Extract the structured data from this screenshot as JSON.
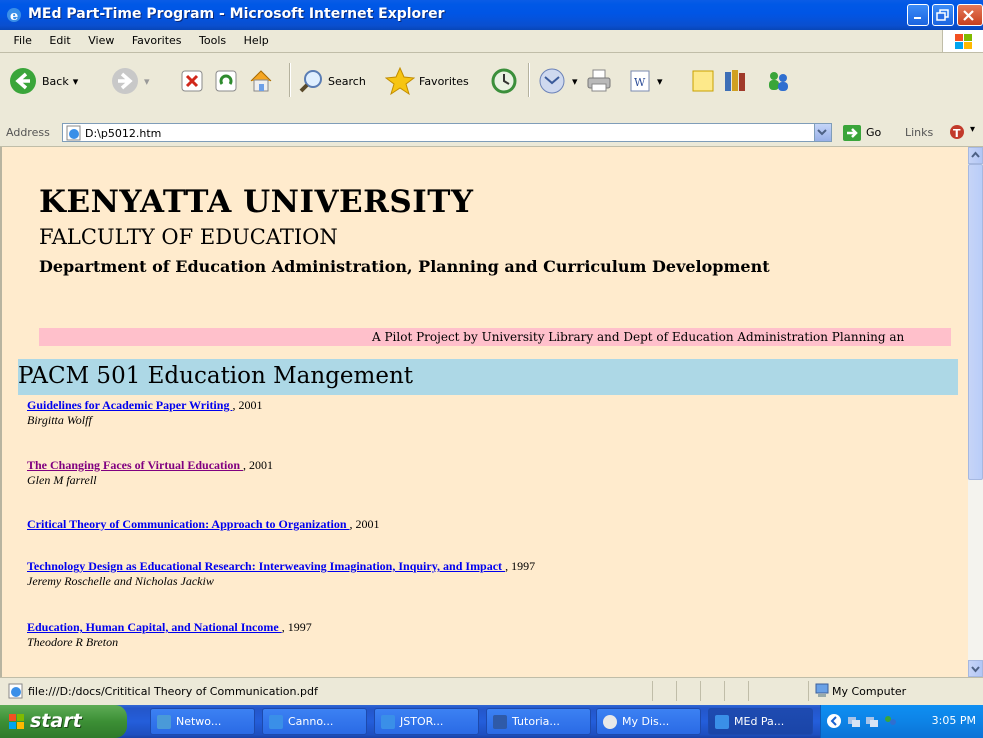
{
  "window": {
    "title": "MEd Part-Time Program - Microsoft Internet Explorer"
  },
  "menu": [
    "File",
    "Edit",
    "View",
    "Favorites",
    "Tools",
    "Help"
  ],
  "toolbar": {
    "back": "Back",
    "search": "Search",
    "favorites": "Favorites"
  },
  "address": {
    "label": "Address",
    "value": "D:\\p5012.htm",
    "go": "Go",
    "links": "Links"
  },
  "page": {
    "university": "KENYATTA UNIVERSITY",
    "faculty": "FALCULTY OF EDUCATION",
    "department": "Department of Education Administration, Planning and Curriculum Development",
    "marquee": "A Pilot Project by University Library and Dept of Education Administration Planning an",
    "course": "PACM 501 Education Mangement",
    "entries": [
      {
        "title": "Guidelines for Academic Paper Writing ",
        "year": ", 2001",
        "author": "Birgitta Wolff",
        "visited": false
      },
      {
        "title": "The Changing Faces of Virtual Education ",
        "year": ", 2001",
        "author": "Glen M farrell",
        "visited": true
      },
      {
        "title": "Critical Theory of Communication: Approach to Organization ",
        "year": ", 2001",
        "author": "",
        "visited": false
      },
      {
        "title": "Technology Design as Educational Research: Interweaving Imagination, Inquiry, and Impact ",
        "year": ", 1997",
        "author": "Jeremy Roschelle and Nicholas Jackiw",
        "visited": false
      },
      {
        "title": "Education, Human Capital, and National Income ",
        "year": ", 1997",
        "author": "Theodore R Breton",
        "visited": false
      }
    ]
  },
  "status": {
    "message": "file:///D:/docs/Crititical Theory of Communication.pdf",
    "zone": "My Computer"
  },
  "taskbar": {
    "start": "start",
    "tasks": [
      "Netwo...",
      "Canno...",
      "JSTOR...",
      "Tutoria...",
      "My Dis...",
      "MEd Pa..."
    ],
    "clock": "3:05 PM"
  }
}
